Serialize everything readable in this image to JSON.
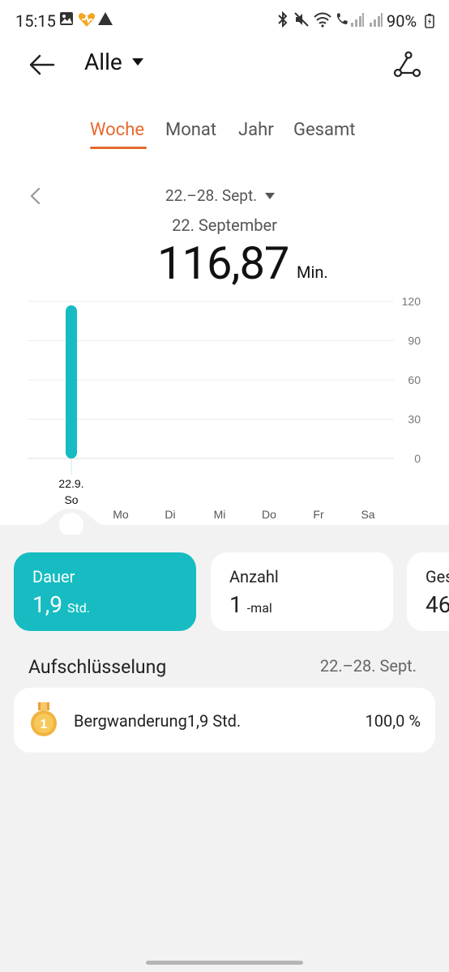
{
  "status_bar": {
    "time": "15:15",
    "battery": "90%"
  },
  "header": {
    "title": "Alle"
  },
  "tabs": [
    {
      "label": "Woche",
      "active": true
    },
    {
      "label": "Monat",
      "active": false
    },
    {
      "label": "Jahr",
      "active": false
    },
    {
      "label": "Gesamt",
      "active": false
    }
  ],
  "period": {
    "range": "22.–28. Sept.",
    "selected_day": "22. September",
    "value": "116,87",
    "unit": "Min."
  },
  "colors": {
    "accent": "#e8692e",
    "bar": "#16bcc1",
    "card_active": "#16bcc1"
  },
  "chart_data": {
    "type": "bar",
    "categories": [
      "So",
      "Mo",
      "Di",
      "Mi",
      "Do",
      "Fr",
      "Sa"
    ],
    "values": [
      116.87,
      0,
      0,
      0,
      0,
      0,
      0
    ],
    "selected_index": 0,
    "selected_date": "22.9.",
    "ylim": [
      0,
      120
    ],
    "yticks": [
      "120",
      "90",
      "60",
      "30",
      "0"
    ],
    "grid": true
  },
  "cards": [
    {
      "label": "Dauer",
      "value": "1,9",
      "unit": "Std.",
      "active": true
    },
    {
      "label": "Anzahl",
      "value": "1",
      "unit": "-mal",
      "active": false
    },
    {
      "label": "Ges",
      "value": "46",
      "unit": "",
      "active": false
    }
  ],
  "breakdown": {
    "title": "Aufschlüsselung",
    "range": "22.–28. Sept.",
    "items": [
      {
        "name": "Bergwanderung",
        "value": "1,9 Std.",
        "percent": "100,0 %",
        "rank": "1",
        "icon": "medal-icon"
      }
    ]
  }
}
